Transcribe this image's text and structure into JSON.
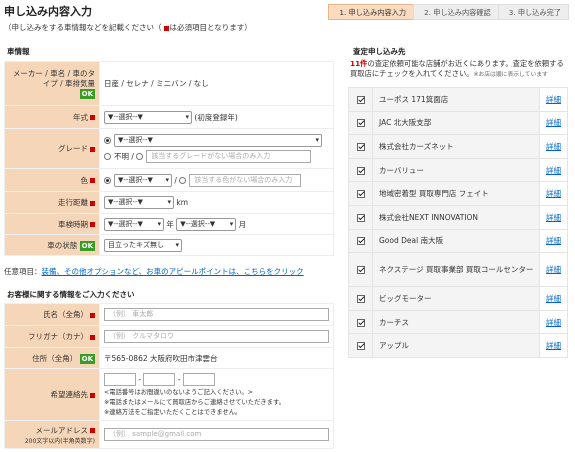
{
  "header": {
    "title": "申し込み内容入力",
    "subtitle_pre": "（申し込みをする車情報などを記載ください（",
    "subtitle_post": "は必須項目となります）"
  },
  "steps": [
    {
      "label": "1. 申し込み内容入力",
      "active": true
    },
    {
      "label": "2. 申し込み内容確認",
      "active": false
    },
    {
      "label": "3. 申し込み完了",
      "active": false
    }
  ],
  "car_section": {
    "heading": "車情報",
    "maker_label": "メーカー / 車名 / 車のタイプ / 車排気量",
    "maker_value": "日産 / セレナ / ミニバン / なし",
    "ok_badge": "OK",
    "year_label": "年式",
    "year_select": "▼--選択--▼",
    "year_note": "(初度登録年)",
    "grade_label": "グレード",
    "grade_select": "▼--選択--▼",
    "grade_unknown": "不明 /",
    "grade_placeholder": "該当するグレードがない場合のみ入力",
    "color_label": "色",
    "color_select": "▼--選択--▼",
    "color_slash": "/",
    "color_placeholder": "該当する色がない場合のみ入力",
    "mileage_label": "走行距離",
    "mileage_select": "▼--選択--▼",
    "mileage_unit": "km",
    "inspection_label": "車検時期",
    "inspection_year_select": "▼--選択--▼",
    "inspection_year_unit": "年",
    "inspection_month_select": "▼--選択--▼",
    "inspection_month_unit": "月",
    "condition_label": "車の状態",
    "condition_select": "目立ったキズ無し"
  },
  "optional": {
    "prefix": "任意項目：",
    "link": "装備、その他オプションなど、お車のアピールポイントは、こちらをクリック"
  },
  "customer_section": {
    "heading": "お客様に関する情報をご入力ください",
    "name_label": "氏名（全角）",
    "name_placeholder": "（例） 車太郎",
    "kana_label": "フリガナ（カナ）",
    "kana_placeholder": "（例） クルマタロウ",
    "address_label": "住所（全角）",
    "address_value": "〒565-0862  大阪府吹田市津雲台",
    "phone_label": "希望連絡先",
    "phone_notes": [
      "<電話番号はお間違いのないようご記入ください。>",
      "※電話またはメールにて買取店からご連絡させていただきます。",
      "※連絡方法をご指定いただくことはできません。"
    ],
    "email_label": "メールアドレス",
    "email_sub": "200文字以内(半角英数字)",
    "email_placeholder": "（例） sample@gmail.com"
  },
  "dealers_section": {
    "heading": "査定申し込み先",
    "intro_count": "11件",
    "intro_text": "の査定依頼可能な店舗がお近くにあります。査定を依頼する買取店にチェックを入れてください。",
    "intro_note": "※お店は順に表示しています",
    "detail_label": "詳細",
    "dealers": [
      "ユーポス 171箕面店",
      "JAC 北大阪支部",
      "株式会社カーズネット",
      "カーバリュー",
      "地域密着型 買取専門店 フェイト",
      "株式会社NEXT INNOVATION",
      "Good Deal 南大阪",
      "ネクステージ 買取事業部 買取コールセンター",
      "ビッグモーター",
      "カーチス",
      "アップル"
    ]
  }
}
